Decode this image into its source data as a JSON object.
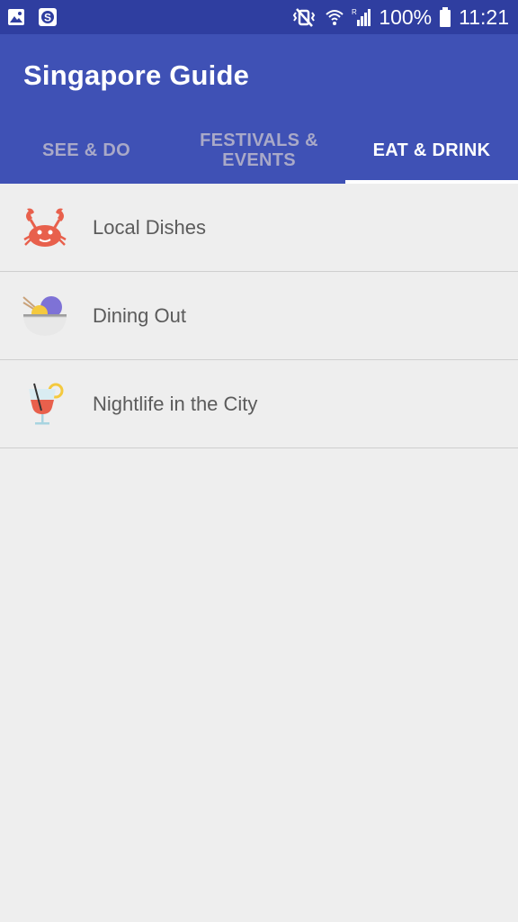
{
  "status_bar": {
    "battery": "100%",
    "time": "11:21"
  },
  "app": {
    "title": "Singapore Guide"
  },
  "tabs": [
    {
      "label": "SEE & DO",
      "active": false
    },
    {
      "label": "FESTIVALS & EVENTS",
      "active": false
    },
    {
      "label": "EAT & DRINK",
      "active": true
    }
  ],
  "list": [
    {
      "label": "Local Dishes",
      "icon": "crab-icon"
    },
    {
      "label": "Dining Out",
      "icon": "bowl-icon"
    },
    {
      "label": "Nightlife in the City",
      "icon": "cocktail-icon"
    }
  ],
  "colors": {
    "status_bar": "#2f3ea0",
    "app_bar": "#3f51b5",
    "background": "#eeeeee",
    "active_tab": "#ffffff",
    "inactive_tab": "#a9a9c8"
  }
}
